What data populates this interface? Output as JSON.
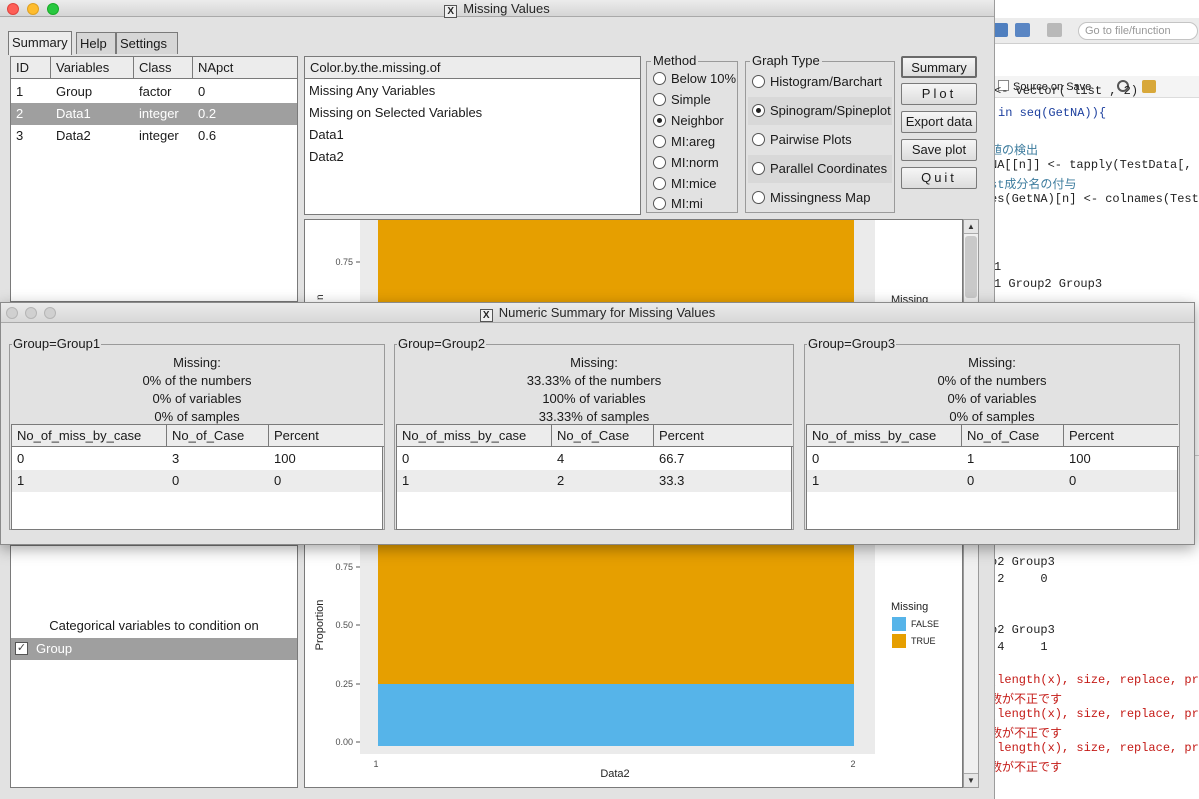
{
  "rstudio": {
    "goto_placeholder": "Go to file/function",
    "source_on_save": "Source on Save",
    "code_lines": [
      {
        "text": "<- vector( list , 2)",
        "kind": "code"
      },
      {
        "text": "in seq(GetNA)){",
        "kind": "kw"
      },
      {
        "text": "値の検出",
        "kind": "cm"
      },
      {
        "text": "NA[[n]] <- tapply(TestData[,",
        "kind": "code"
      },
      {
        "text": "st成分名の付与",
        "kind": "cm"
      },
      {
        "text": "es(GetNA)[n] <- colnames(Test",
        "kind": "code"
      },
      {
        "text": "1",
        "kind": "code"
      },
      {
        "text": "1 Group2 Group3",
        "kind": "code"
      },
      {
        "text": "o2 Group3",
        "kind": "code"
      },
      {
        "text": " 2     0",
        "kind": "code"
      },
      {
        "text": "o2 Group3",
        "kind": "code"
      },
      {
        "text": " 4     1",
        "kind": "code"
      },
      {
        "text": "(length(x), size, replace, pr",
        "kind": "err"
      },
      {
        "text": "数が不正です",
        "kind": "err"
      },
      {
        "text": "(length(x), size, replace, pr",
        "kind": "err"
      },
      {
        "text": "数が不正です",
        "kind": "err"
      },
      {
        "text": "(length(x), size, replace, pr",
        "kind": "err"
      },
      {
        "text": "数が不正です",
        "kind": "err"
      }
    ]
  },
  "main_window": {
    "title": "Missing Values",
    "x_glyph": "X",
    "tabs": [
      {
        "label": "Summary",
        "active": true
      },
      {
        "label": "Help",
        "active": false
      },
      {
        "label": "Settings",
        "active": false
      }
    ],
    "var_table": {
      "headers": [
        "ID",
        "Variables",
        "Class",
        "NApct"
      ],
      "rows": [
        {
          "cells": [
            "1",
            "Group",
            "factor",
            "0"
          ],
          "selected": false
        },
        {
          "cells": [
            "2",
            "Data1",
            "integer",
            "0.2"
          ],
          "selected": true
        },
        {
          "cells": [
            "3",
            "Data2",
            "integer",
            "0.6"
          ],
          "selected": false
        }
      ]
    },
    "color_by": {
      "header": "Color.by.the.missing.of",
      "items": [
        "Missing Any Variables",
        "Missing on Selected Variables",
        "Data1",
        "Data2"
      ]
    },
    "method": {
      "title": "Method",
      "options": [
        {
          "label": "Below 10%",
          "checked": false
        },
        {
          "label": "Simple",
          "checked": false
        },
        {
          "label": "Neighbor",
          "checked": true
        },
        {
          "label": "MI:areg",
          "checked": false
        },
        {
          "label": "MI:norm",
          "checked": false
        },
        {
          "label": "MI:mice",
          "checked": false
        },
        {
          "label": "MI:mi",
          "checked": false
        }
      ]
    },
    "graph_type": {
      "title": "Graph Type",
      "options": [
        {
          "label": "Histogram/Barchart",
          "checked": false
        },
        {
          "label": "Spinogram/Spineplot",
          "checked": true
        },
        {
          "label": "Pairwise Plots",
          "checked": false
        },
        {
          "label": "Parallel Coordinates",
          "checked": false
        },
        {
          "label": "Missingness Map",
          "checked": false
        }
      ]
    },
    "buttons": {
      "summary": "Summary",
      "plot": "Plot",
      "export": "Export data",
      "save_plot": "Save plot",
      "quit": "Quit"
    },
    "condition": {
      "label": "Categorical variables to condition on",
      "items": [
        {
          "label": "Group",
          "checked": true
        }
      ]
    }
  },
  "chart_data": {
    "type": "bar",
    "subtype": "spineplot",
    "xlabel": "Data2",
    "ylabel": "Proportion",
    "ylabel_top_partial": "n",
    "x_tick_labels": [
      "1",
      "2"
    ],
    "ylim": [
      0,
      1
    ],
    "y_ticks": [
      0.0,
      0.25,
      0.5,
      0.75
    ],
    "y_tick_labels": [
      "0.00",
      "0.25",
      "0.50",
      "0.75"
    ],
    "legend": {
      "title": "Missing",
      "placement": "right"
    },
    "series": [
      {
        "name": "FALSE",
        "color": "#56b4e9",
        "values": [
          0.25
        ]
      },
      {
        "name": "TRUE",
        "color": "#e69f00",
        "values": [
          0.75
        ]
      }
    ],
    "grid": true,
    "panel_background": "#ebebeb"
  },
  "summary_window": {
    "title": "Numeric Summary for Missing Values",
    "x_glyph": "X",
    "groups": [
      {
        "title": "Group=Group1",
        "stats": [
          "Missing:",
          "0% of the numbers",
          "0% of variables",
          "0% of samples"
        ],
        "headers": [
          "No_of_miss_by_case",
          "No_of_Case",
          "Percent"
        ],
        "rows": [
          [
            "0",
            "3",
            "100"
          ],
          [
            "1",
            "0",
            "0"
          ]
        ]
      },
      {
        "title": "Group=Group2",
        "stats": [
          "Missing:",
          "33.33% of the numbers",
          "100% of variables",
          "33.33% of samples"
        ],
        "headers": [
          "No_of_miss_by_case",
          "No_of_Case",
          "Percent"
        ],
        "rows": [
          [
            "0",
            "4",
            "66.7"
          ],
          [
            "1",
            "2",
            "33.3"
          ]
        ]
      },
      {
        "title": "Group=Group3",
        "stats": [
          "Missing:",
          "0% of the numbers",
          "0% of variables",
          "0% of samples"
        ],
        "headers": [
          "No_of_miss_by_case",
          "No_of_Case",
          "Percent"
        ],
        "rows": [
          [
            "0",
            "1",
            "100"
          ],
          [
            "1",
            "0",
            "0"
          ]
        ]
      }
    ]
  },
  "colors": {
    "false_blue": "#56b4e9",
    "true_orange": "#e69f00",
    "selection_gray": "#9f9f9f"
  }
}
